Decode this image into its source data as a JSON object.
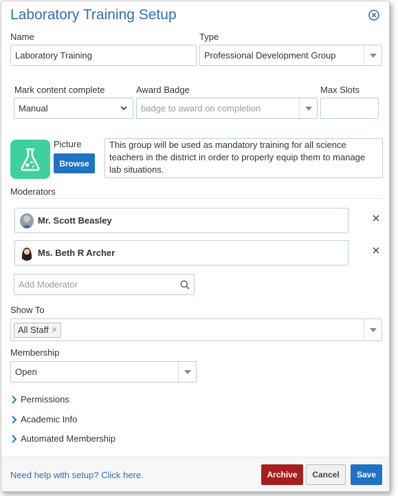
{
  "dialog": {
    "title": "Laboratory Training Setup"
  },
  "name_field": {
    "label": "Name",
    "value": "Laboratory Training"
  },
  "type_field": {
    "label": "Type",
    "value": "Professional Development Group"
  },
  "mark_complete": {
    "label": "Mark content complete",
    "value": "Manual"
  },
  "award_badge": {
    "label": "Award Badge",
    "placeholder": "badge to award on completion"
  },
  "max_slots": {
    "label": "Max Slots",
    "value": ""
  },
  "picture": {
    "label": "Picture",
    "browse_label": "Browse",
    "icon": "flask-icon"
  },
  "description": "This group will be used as mandatory training for all science teachers in the district in order to properly equip them to manage lab situations.",
  "moderators": {
    "label": "Moderators",
    "items": [
      {
        "name": "Mr. Scott Beasley"
      },
      {
        "name": "Ms. Beth R Archer"
      }
    ],
    "add_placeholder": "Add Moderator"
  },
  "show_to": {
    "label": "Show To",
    "chips": [
      "All Staff"
    ]
  },
  "membership": {
    "label": "Membership",
    "value": "Open"
  },
  "sections": [
    "Permissions",
    "Academic Info",
    "Automated Membership"
  ],
  "footer": {
    "help_text": "Need help with setup? Click here.",
    "archive_label": "Archive",
    "cancel_label": "Cancel",
    "save_label": "Save"
  },
  "colors": {
    "title": "#2f6fb5",
    "primary": "#1f72c4",
    "archive": "#a81e1e",
    "picture_tile": "#3ed09f"
  }
}
